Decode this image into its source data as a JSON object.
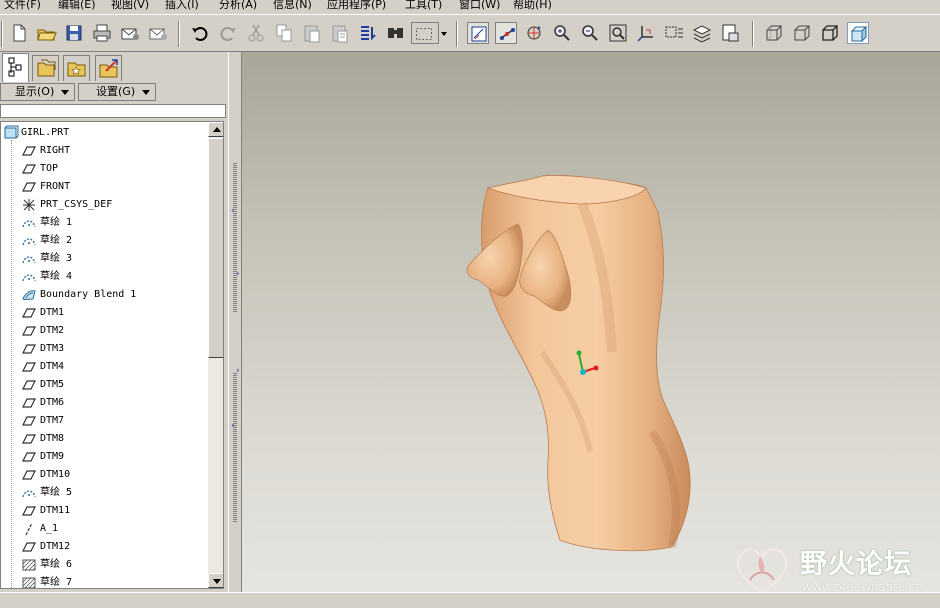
{
  "menu": [
    {
      "id": "file",
      "label": "文件(F)"
    },
    {
      "id": "edit",
      "label": "编辑(E)"
    },
    {
      "id": "view",
      "label": "视图(V)"
    },
    {
      "id": "insert",
      "label": "插入(I)"
    },
    {
      "id": "analysis",
      "label": "分析(A)"
    },
    {
      "id": "info",
      "label": "信息(N)"
    },
    {
      "id": "apps",
      "label": "应用程序(P)"
    },
    {
      "id": "tools",
      "label": "工具(T)"
    },
    {
      "id": "window",
      "label": "窗口(W)"
    },
    {
      "id": "help",
      "label": "帮助(H)"
    }
  ],
  "toolbar_icons": [
    "new-file-icon",
    "open-folder-icon",
    "save-icon",
    "print-icon",
    "send-mail-icon",
    "mail-attach-icon",
    "undo-icon",
    "redo-icon",
    "cut-icon",
    "copy-icon",
    "paste-icon",
    "paste-special-icon",
    "regenerate-icon",
    "find-icon",
    "select-box-icon",
    "select-dropdown-icon",
    "datum-plane-display-icon",
    "datum-axis-display-icon",
    "spin-center-icon",
    "zoom-in-icon",
    "zoom-out-icon",
    "refit-icon",
    "reorient-icon",
    "view-list-icon",
    "layers-icon",
    "view-manager-icon",
    "wireframe-icon",
    "hidden-line-icon",
    "no-hidden-icon",
    "shading-icon"
  ],
  "panel": {
    "tabs": [
      "model-tree-tab",
      "folder-browser-tab",
      "favorites-tab",
      "web-tab"
    ],
    "show_label": "显示(O)",
    "settings_label": "设置(G)"
  },
  "tree": {
    "root": "GIRL.PRT",
    "items": [
      {
        "label": "RIGHT",
        "icon": "datum-plane-icon"
      },
      {
        "label": "TOP",
        "icon": "datum-plane-icon"
      },
      {
        "label": "FRONT",
        "icon": "datum-plane-icon"
      },
      {
        "label": "PRT_CSYS_DEF",
        "icon": "coordinate-system-icon"
      },
      {
        "label": "草绘 1",
        "icon": "sketch-icon"
      },
      {
        "label": "草绘 2",
        "icon": "sketch-icon"
      },
      {
        "label": "草绘 3",
        "icon": "sketch-icon"
      },
      {
        "label": "草绘 4",
        "icon": "sketch-icon"
      },
      {
        "label": "Boundary Blend 1",
        "icon": "boundary-blend-icon"
      },
      {
        "label": "DTM1",
        "icon": "datum-plane-icon"
      },
      {
        "label": "DTM2",
        "icon": "datum-plane-icon"
      },
      {
        "label": "DTM3",
        "icon": "datum-plane-icon"
      },
      {
        "label": "DTM4",
        "icon": "datum-plane-icon"
      },
      {
        "label": "DTM5",
        "icon": "datum-plane-icon"
      },
      {
        "label": "DTM6",
        "icon": "datum-plane-icon"
      },
      {
        "label": "DTM7",
        "icon": "datum-plane-icon"
      },
      {
        "label": "DTM8",
        "icon": "datum-plane-icon"
      },
      {
        "label": "DTM9",
        "icon": "datum-plane-icon"
      },
      {
        "label": "DTM10",
        "icon": "datum-plane-icon"
      },
      {
        "label": "草绘 5",
        "icon": "sketch-icon"
      },
      {
        "label": "DTM11",
        "icon": "datum-plane-icon"
      },
      {
        "label": "A_1",
        "icon": "datum-axis-icon"
      },
      {
        "label": "DTM12",
        "icon": "datum-plane-icon"
      },
      {
        "label": "草绘 6",
        "icon": "hatched-sketch-icon"
      },
      {
        "label": "草绘 7",
        "icon": "hatched-sketch-icon"
      }
    ]
  },
  "watermark": {
    "title": "野火论坛",
    "url": "www.proewildfire.cn"
  },
  "colors": {
    "skin": "#f2c497",
    "skin_shadow": "#c98d5e",
    "viewport_top": "#a9a598",
    "viewport_bottom": "#e6e4df"
  }
}
